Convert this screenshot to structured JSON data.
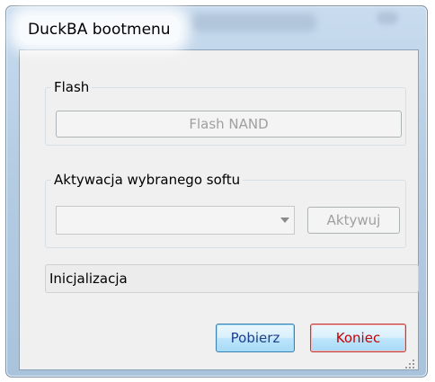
{
  "window": {
    "title": "DuckBA bootmenu"
  },
  "flash_group": {
    "title": "Flash",
    "flash_button_label": "Flash NAND"
  },
  "activation_group": {
    "title": "Aktywacja wybranego softu",
    "combo_value": "",
    "activate_button_label": "Aktywuj"
  },
  "status": {
    "text": "Inicjalizacja"
  },
  "footer": {
    "download_label": "Pobierz",
    "exit_label": "Koniec"
  },
  "colors": {
    "exit_text": "#c80000",
    "download_text": "#1f3f8a",
    "disabled_text": "#a0a0a0"
  }
}
